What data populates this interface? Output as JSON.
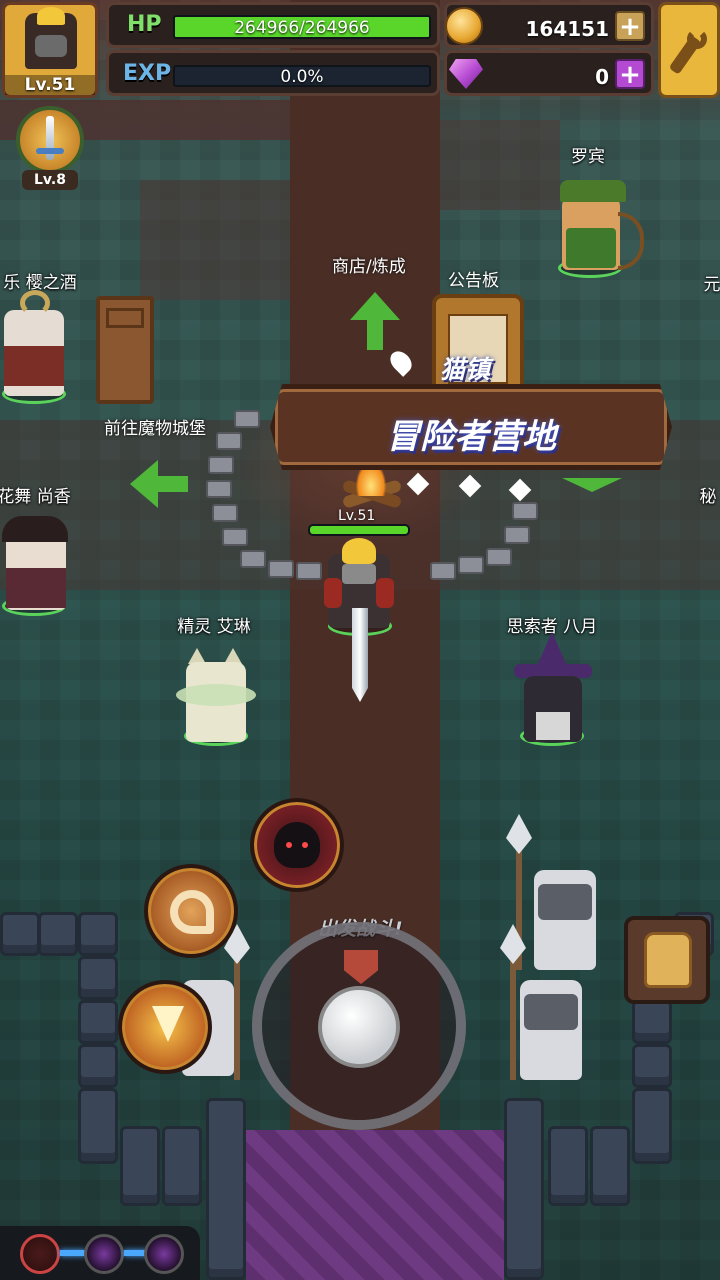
{
  "player": {
    "level": "Lv.51",
    "overhead_level": "Lv.51"
  },
  "pet": {
    "level": "Lv.8"
  },
  "hp": {
    "label": "HP",
    "text": "264966/264966",
    "fill": 1.0
  },
  "exp": {
    "label": "EXP",
    "text": "0.0%",
    "fill": 0.0
  },
  "gold": {
    "value": "164151",
    "plus": "+"
  },
  "gems": {
    "value": "0",
    "plus": "+"
  },
  "banner": {
    "town": "猫镇",
    "title": "冒险者营地"
  },
  "locations": {
    "shop": "商店/炼成",
    "notice_board": "公告板",
    "castle": "前往魔物城堡"
  },
  "npcs": {
    "luobin": "罗宾",
    "sakura": "乐 樱之酒",
    "hanamai": "花舞 尚香",
    "elf": "精灵 艾琳",
    "thinker": "思索者 八月",
    "right_top": "元",
    "right_mid": "秘"
  },
  "joystick": {
    "hint": "出发战斗!"
  },
  "colors": {
    "hp": "#5ad62a",
    "exp": "#3b4a8f",
    "accent": "#e7b43a",
    "gem": "#b54ad2"
  }
}
